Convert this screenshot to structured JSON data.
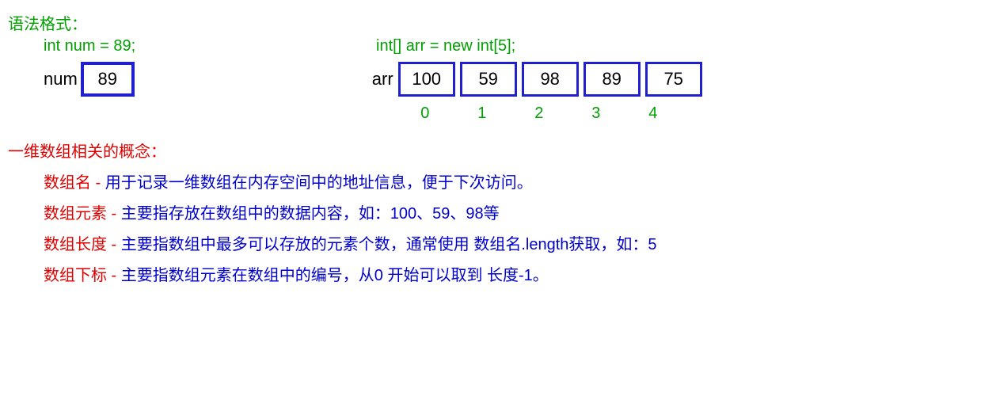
{
  "header": "语法格式：",
  "code": {
    "left": "int num = 89;",
    "right": "int[] arr = new int[5];"
  },
  "num": {
    "label": "num",
    "value": "89"
  },
  "arr": {
    "label": "arr",
    "cells": [
      "100",
      "59",
      "98",
      "89",
      "75"
    ],
    "indices": [
      "0",
      "1",
      "2",
      "3",
      "4"
    ]
  },
  "concept_header": "一维数组相关的概念：",
  "defs": [
    {
      "term": "数组名",
      "sep": " - ",
      "desc": "用于记录一维数组在内存空间中的地址信息，便于下次访问。"
    },
    {
      "term": "数组元素",
      "sep": " - ",
      "desc": "主要指存放在数组中的数据内容，如：100、59、98等"
    },
    {
      "term": "数组长度",
      "sep": " - ",
      "desc": "主要指数组中最多可以存放的元素个数，通常使用 数组名.length获取，如：5"
    },
    {
      "term": "数组下标",
      "sep": " - ",
      "desc": "主要指数组元素在数组中的编号，从0 开始可以取到 长度-1。"
    }
  ]
}
